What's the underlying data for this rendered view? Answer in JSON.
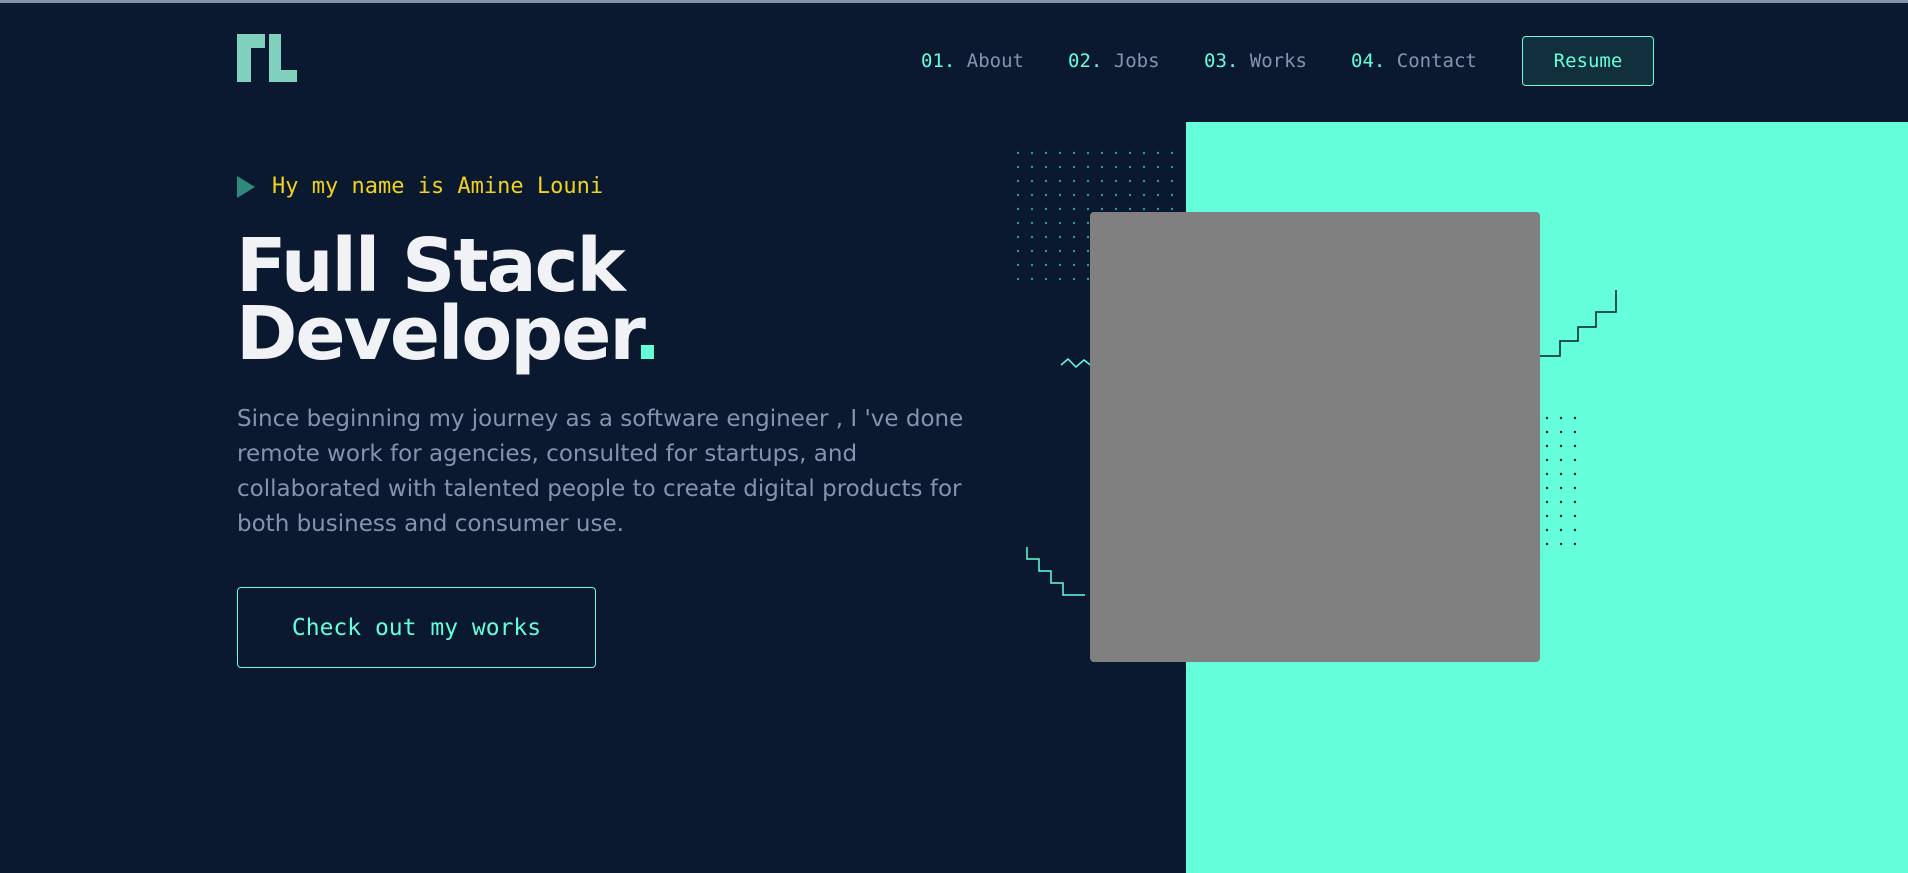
{
  "brand": {
    "logo_icon": "nl-monogram-logo-icon",
    "accent": "#64ffda",
    "background": "#0a192f"
  },
  "nav": {
    "items": [
      {
        "num": "01.",
        "label": "About"
      },
      {
        "num": "02.",
        "label": "Jobs"
      },
      {
        "num": "03.",
        "label": "Works"
      },
      {
        "num": "04.",
        "label": "Contact"
      }
    ],
    "resume_label": "Resume"
  },
  "hero": {
    "greeting": "Hy my name is Amine Louni",
    "title_line1": "Full Stack",
    "title_line2": "Developer",
    "title_dot": ".",
    "description": "Since beginning my journey as a software engineer , I 've done remote work for agencies, consulted for startups, and collaborated with talented people to create digital products for both business and consumer use.",
    "cta_label": "Check out my works"
  },
  "colors": {
    "greeting": "#f0d21c",
    "photo_placeholder": "#808080"
  }
}
